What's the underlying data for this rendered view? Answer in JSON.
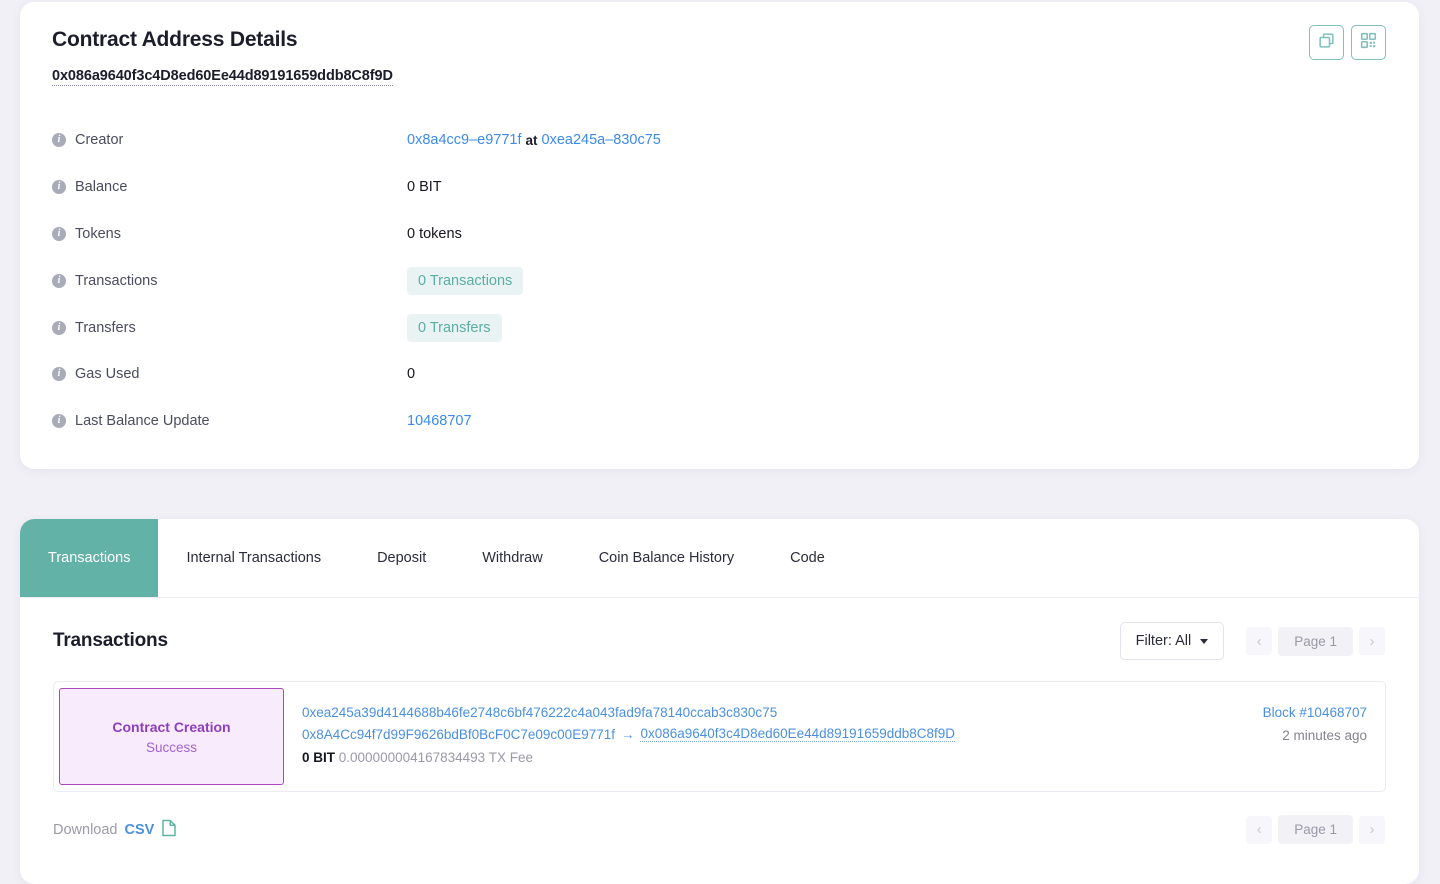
{
  "details_card": {
    "title": "Contract Address Details",
    "contract_address": "0x086a9640f3c4D8ed60Ee44d89191659ddb8C8f9D",
    "actions": [
      {
        "name": "copy-icon",
        "label": "Copy address"
      },
      {
        "name": "qr-code-icon",
        "label": "Show QR code"
      }
    ],
    "rows": [
      {
        "label": "Creator",
        "type": "creator",
        "creator_address": "0x8a4cc9–e9771f",
        "at_word": "at",
        "creation_tx": "0xea245a–830c75"
      },
      {
        "label": "Balance",
        "type": "text",
        "value": "0 BIT"
      },
      {
        "label": "Tokens",
        "type": "text",
        "value": "0 tokens"
      },
      {
        "label": "Transactions",
        "type": "badge",
        "value": "0 Transactions"
      },
      {
        "label": "Transfers",
        "type": "badge",
        "value": "0 Transfers"
      },
      {
        "label": "Gas Used",
        "type": "text",
        "value": "0"
      },
      {
        "label": "Last Balance Update",
        "type": "link",
        "value": "10468707"
      }
    ]
  },
  "tx_card": {
    "tabs": [
      {
        "label": "Transactions",
        "active": true
      },
      {
        "label": "Internal Transactions",
        "active": false
      },
      {
        "label": "Deposit",
        "active": false
      },
      {
        "label": "Withdraw",
        "active": false
      },
      {
        "label": "Coin Balance History",
        "active": false
      },
      {
        "label": "Code",
        "active": false
      }
    ],
    "section_title": "Transactions",
    "filter_label": "Filter: All",
    "pagination": {
      "prev": "‹",
      "page_label": "Page 1",
      "next": "›"
    },
    "transactions": [
      {
        "type_main": "Contract Creation",
        "type_sub": "Success",
        "hash": "0xea245a39d4144688b46fe2748c6bf476222c4a043fad9fa78140ccab3c830c75",
        "from": "0x8A4Cc94f7d99F9626bdBf0BcF0C7e09c00E9771f",
        "arrow": "→",
        "to": "0x086a9640f3c4D8ed60Ee44d89191659ddb8C8f9D",
        "value": "0 BIT",
        "fee": "0.000000004167834493 TX Fee",
        "block": "Block #10468707",
        "age": "2 minutes ago"
      }
    ],
    "footer": {
      "download_label": "Download",
      "download_format": "CSV"
    }
  },
  "colors": {
    "accent_teal": "#63b2a8",
    "link_blue": "#4a90e2",
    "badge_bg": "#e9f3f3",
    "badge_text": "#5aada4",
    "purple_border": "#ab47bc",
    "purple_bg": "#f8ebfb",
    "page_bg": "#f1f0f6"
  }
}
